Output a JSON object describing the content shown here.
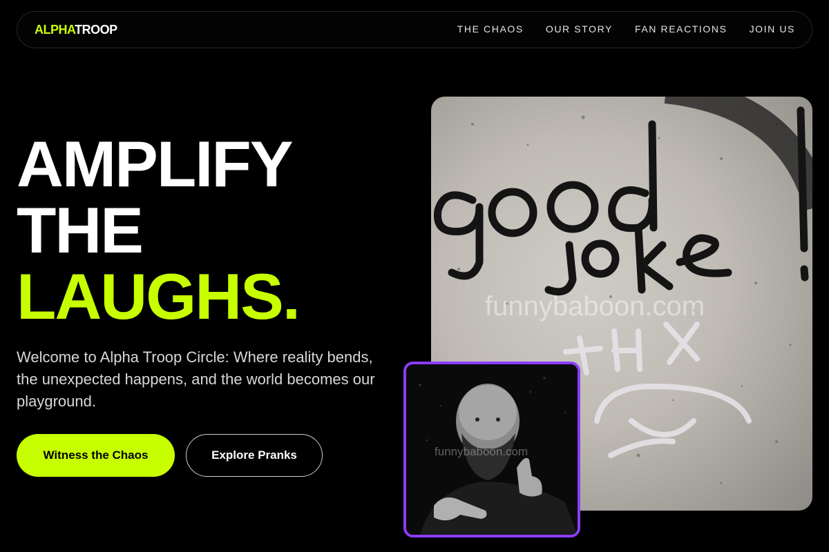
{
  "brand": {
    "part1": "ALPHA",
    "part2": "TROOP"
  },
  "nav": {
    "links": [
      "THE CHAOS",
      "OUR STORY",
      "FAN REACTIONS",
      "JOIN US"
    ]
  },
  "hero": {
    "line1": "AMPLIFY",
    "line2": "THE",
    "line3": "LAUGHS.",
    "intro": "Welcome to Alpha Troop Circle: Where reality bends, the unexpected happens, and the world becomes our playground.",
    "primary_button": "Witness the Chaos",
    "secondary_button": "Explore Pranks"
  },
  "images": {
    "wall_graffiti_text": "good joke",
    "wall_graffiti_sub": "THX",
    "watermark": "funnybaboon.com"
  },
  "colors": {
    "accent": "#c8ff00",
    "background": "#000000",
    "portrait_border": "#8c3cff"
  }
}
